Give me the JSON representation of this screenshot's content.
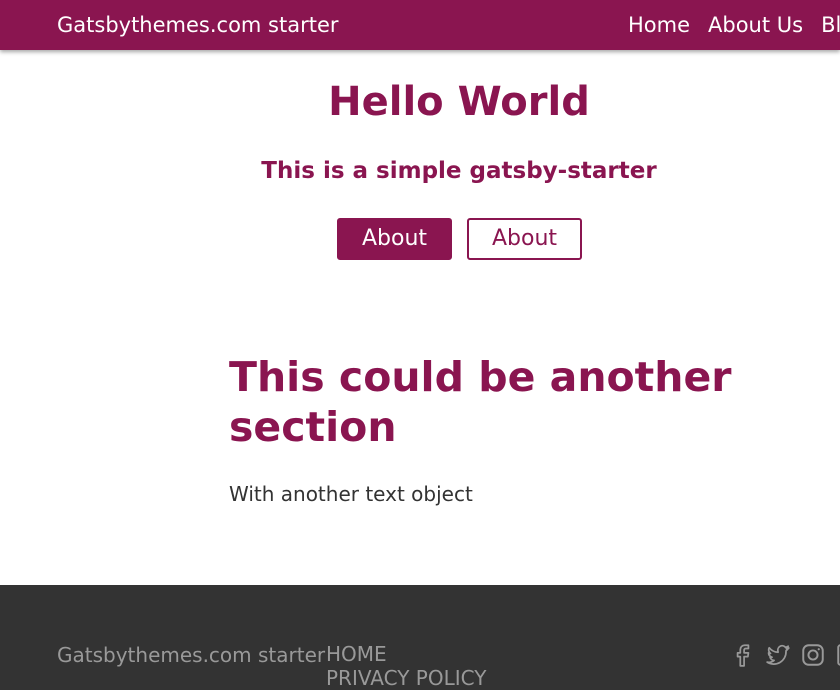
{
  "header": {
    "brand": "Gatsbythemes.com starter",
    "nav": [
      "Home",
      "About Us",
      "Blog"
    ]
  },
  "hero": {
    "title": "Hello World",
    "subtitle": "This is a simple gatsby-starter",
    "primary_button": "About",
    "secondary_button": "About"
  },
  "section": {
    "title": "This could be another section",
    "text": "With another text object"
  },
  "footer": {
    "brand": "Gatsbythemes.com starter",
    "links": [
      "HOME",
      "PRIVACY POLICY"
    ],
    "social_icons": [
      "facebook-icon",
      "twitter-icon",
      "instagram-icon",
      "linkedin-icon"
    ]
  },
  "colors": {
    "brand": "#8a1550",
    "footer_bg": "#333333",
    "footer_text": "#999999",
    "body_text": "#333333"
  }
}
